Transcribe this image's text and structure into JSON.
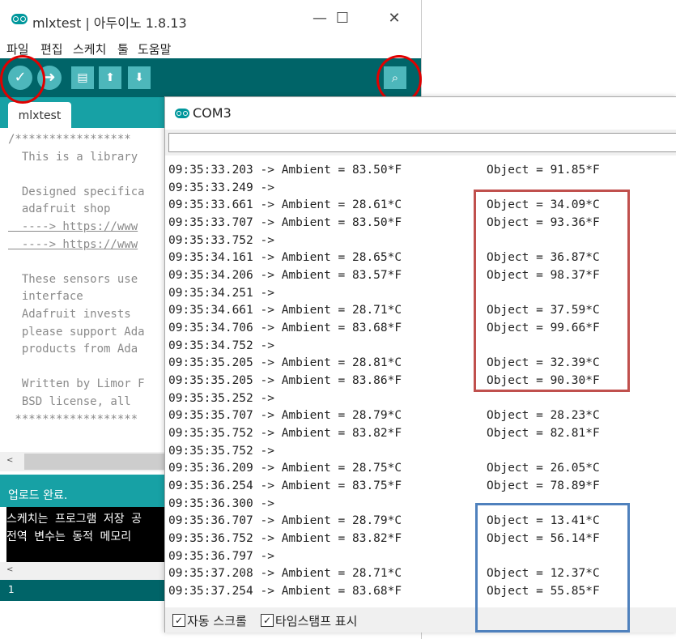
{
  "ide": {
    "title": "mlxtest | 아두이노 1.8.13",
    "window_controls": {
      "minimize": "—",
      "maximize": "☐",
      "close": "✕"
    },
    "menu": [
      "파일",
      "편집",
      "스케치",
      "툴",
      "도움말"
    ],
    "toolbar": {
      "verify_icon": "✓",
      "upload_icon": "➜",
      "new_icon": "▤",
      "open_icon": "⬆",
      "save_icon": "⬇",
      "serial_monitor_icon": "⌕"
    },
    "tab": "mlxtest",
    "code_lines": [
      "/*****************",
      "  This is a library",
      "",
      "  Designed specifica",
      "  adafruit shop",
      "  ----> https://www",
      "  ----> https://www",
      "",
      "  These sensors use",
      "  interface",
      "  Adafruit invests",
      "  please support Ada",
      "  products from Ada",
      "",
      "  Written by Limor F",
      "  BSD license, all",
      " ******************"
    ],
    "link_lines": [
      5,
      6
    ],
    "status": "업로드 완료.",
    "console_lines": [
      "스케치는 프로그램 저장 공",
      "전역 변수는 동적 메모리"
    ],
    "line_number": "1",
    "scroll_left_arrow": "<"
  },
  "serial": {
    "title": "COM3",
    "input_value": "",
    "rows": [
      {
        "ts": "09:35:33.203",
        "ambient": "Ambient = 83.50*F",
        "object": "Object = 91.85*F"
      },
      {
        "ts": "09:35:33.249",
        "ambient": "",
        "object": ""
      },
      {
        "ts": "09:35:33.661",
        "ambient": "Ambient = 28.61*C",
        "object": "Object = 34.09*C"
      },
      {
        "ts": "09:35:33.707",
        "ambient": "Ambient = 83.50*F",
        "object": "Object = 93.36*F"
      },
      {
        "ts": "09:35:33.752",
        "ambient": "",
        "object": ""
      },
      {
        "ts": "09:35:34.161",
        "ambient": "Ambient = 28.65*C",
        "object": "Object = 36.87*C"
      },
      {
        "ts": "09:35:34.206",
        "ambient": "Ambient = 83.57*F",
        "object": "Object = 98.37*F"
      },
      {
        "ts": "09:35:34.251",
        "ambient": "",
        "object": ""
      },
      {
        "ts": "09:35:34.661",
        "ambient": "Ambient = 28.71*C",
        "object": "Object = 37.59*C"
      },
      {
        "ts": "09:35:34.706",
        "ambient": "Ambient = 83.68*F",
        "object": "Object = 99.66*F"
      },
      {
        "ts": "09:35:34.752",
        "ambient": "",
        "object": ""
      },
      {
        "ts": "09:35:35.205",
        "ambient": "Ambient = 28.81*C",
        "object": "Object = 32.39*C"
      },
      {
        "ts": "09:35:35.205",
        "ambient": "Ambient = 83.86*F",
        "object": "Object = 90.30*F"
      },
      {
        "ts": "09:35:35.252",
        "ambient": "",
        "object": ""
      },
      {
        "ts": "09:35:35.707",
        "ambient": "Ambient = 28.79*C",
        "object": "Object = 28.23*C"
      },
      {
        "ts": "09:35:35.752",
        "ambient": "Ambient = 83.82*F",
        "object": "Object = 82.81*F"
      },
      {
        "ts": "09:35:35.752",
        "ambient": "",
        "object": ""
      },
      {
        "ts": "09:35:36.209",
        "ambient": "Ambient = 28.75*C",
        "object": "Object = 26.05*C"
      },
      {
        "ts": "09:35:36.254",
        "ambient": "Ambient = 83.75*F",
        "object": "Object = 78.89*F"
      },
      {
        "ts": "09:35:36.300",
        "ambient": "",
        "object": ""
      },
      {
        "ts": "09:35:36.707",
        "ambient": "Ambient = 28.79*C",
        "object": "Object = 13.41*C"
      },
      {
        "ts": "09:35:36.752",
        "ambient": "Ambient = 83.82*F",
        "object": "Object = 56.14*F"
      },
      {
        "ts": "09:35:36.797",
        "ambient": "",
        "object": ""
      },
      {
        "ts": "09:35:37.208",
        "ambient": "Ambient = 28.71*C",
        "object": "Object = 12.37*C"
      },
      {
        "ts": "09:35:37.254",
        "ambient": "Ambient = 83.68*F",
        "object": "Object = 55.85*F"
      }
    ],
    "arrow": "->",
    "autoscroll_label": "자동 스크롤",
    "timestamp_label": "타임스탬프 표시",
    "check_mark": "✓"
  },
  "colors": {
    "teal_dark": "#006468",
    "teal_mid": "#17a1a5",
    "teal_light": "#4db7bb",
    "annotation_red": "#e00000",
    "box_red": "#c0504d",
    "box_blue": "#4f81bd"
  }
}
